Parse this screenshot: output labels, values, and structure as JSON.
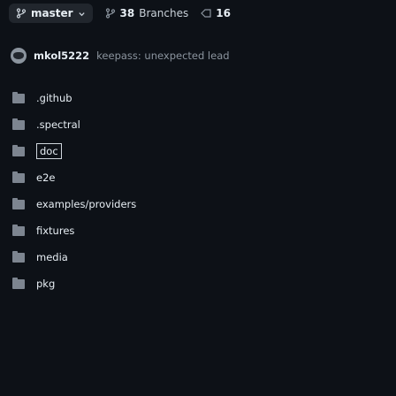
{
  "branch": {
    "name": "master",
    "icon": "branch-icon"
  },
  "branches": {
    "count": "38",
    "label": "Branches"
  },
  "tags": {
    "count": "16"
  },
  "commit": {
    "author": "mkol5222",
    "message": "keepass: unexpected lead"
  },
  "files": [
    {
      "name": ".github",
      "type": "folder"
    },
    {
      "name": ".spectral",
      "type": "folder"
    },
    {
      "name": "doc",
      "type": "folder",
      "selected": true
    },
    {
      "name": "e2e",
      "type": "folder"
    },
    {
      "name": "examples/providers",
      "type": "folder"
    },
    {
      "name": "fixtures",
      "type": "folder"
    },
    {
      "name": "media",
      "type": "folder"
    },
    {
      "name": "pkg",
      "type": "folder"
    }
  ]
}
